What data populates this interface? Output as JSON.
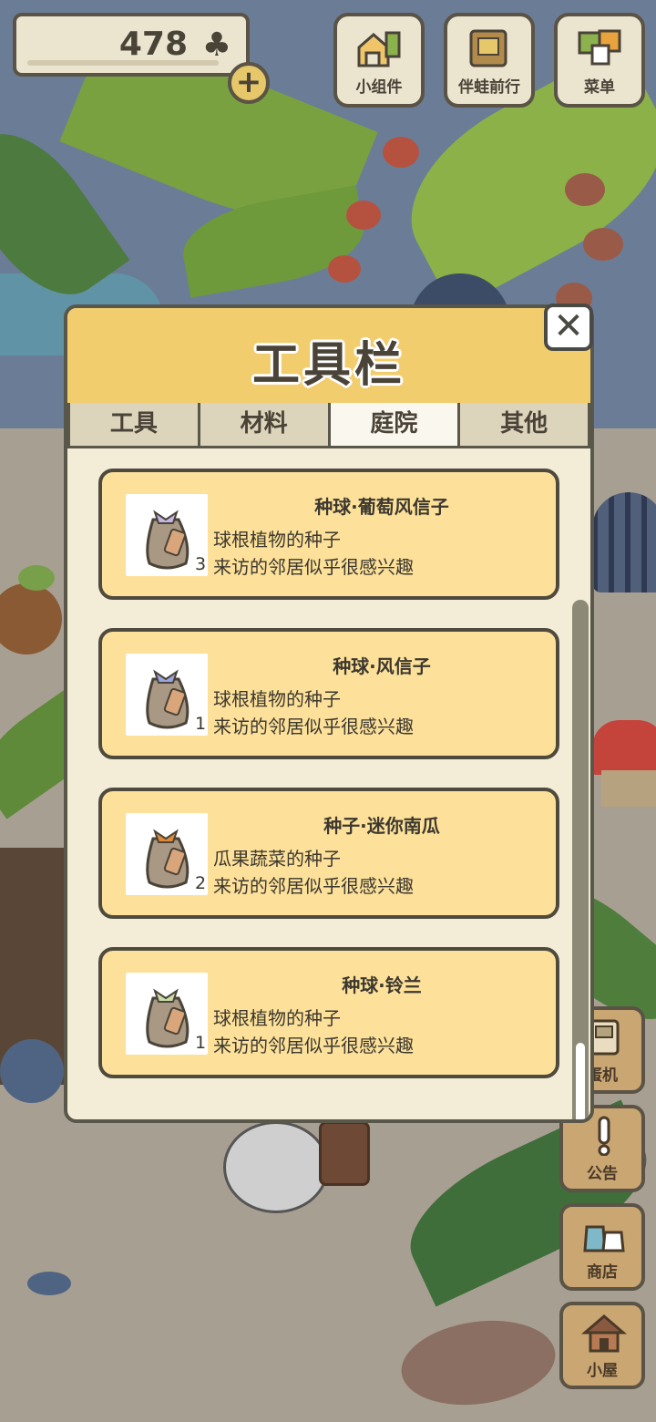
{
  "hud": {
    "clover_count": "478",
    "clover_icon": "♣",
    "add_icon": "+"
  },
  "top_buttons": [
    {
      "label": "小组件",
      "icon": "widget-icon"
    },
    {
      "label": "伴蛙前行",
      "icon": "journey-book-icon"
    },
    {
      "label": "菜单",
      "icon": "menu-cards-icon"
    }
  ],
  "side_buttons": [
    {
      "label": "蛋机",
      "icon": "gacha-machine-icon"
    },
    {
      "label": "公告",
      "icon": "exclamation-icon"
    },
    {
      "label": "商店",
      "icon": "shop-bags-icon"
    },
    {
      "label": "小屋",
      "icon": "house-icon"
    }
  ],
  "toolbar": {
    "title": "工具栏",
    "close_icon": "✕",
    "tabs": [
      {
        "label": "工具",
        "active": false
      },
      {
        "label": "材料",
        "active": false
      },
      {
        "label": "庭院",
        "active": true
      },
      {
        "label": "其他",
        "active": false
      }
    ],
    "items": [
      {
        "name": "种球·葡萄风信子",
        "desc1": "球根植物的种子",
        "desc2": "来访的邻居似乎很感兴趣",
        "qty": "3",
        "tie_color": "#c6b6e6"
      },
      {
        "name": "种球·风信子",
        "desc1": "球根植物的种子",
        "desc2": "来访的邻居似乎很感兴趣",
        "qty": "1",
        "tie_color": "#9aa6e0"
      },
      {
        "name": "种子·迷你南瓜",
        "desc1": "瓜果蔬菜的种子",
        "desc2": "来访的邻居似乎很感兴趣",
        "qty": "2",
        "tie_color": "#e08a3a"
      },
      {
        "name": "种球·铃兰",
        "desc1": "球根植物的种子",
        "desc2": "来访的邻居似乎很感兴趣",
        "qty": "1",
        "tie_color": "#c9dca8"
      }
    ]
  }
}
